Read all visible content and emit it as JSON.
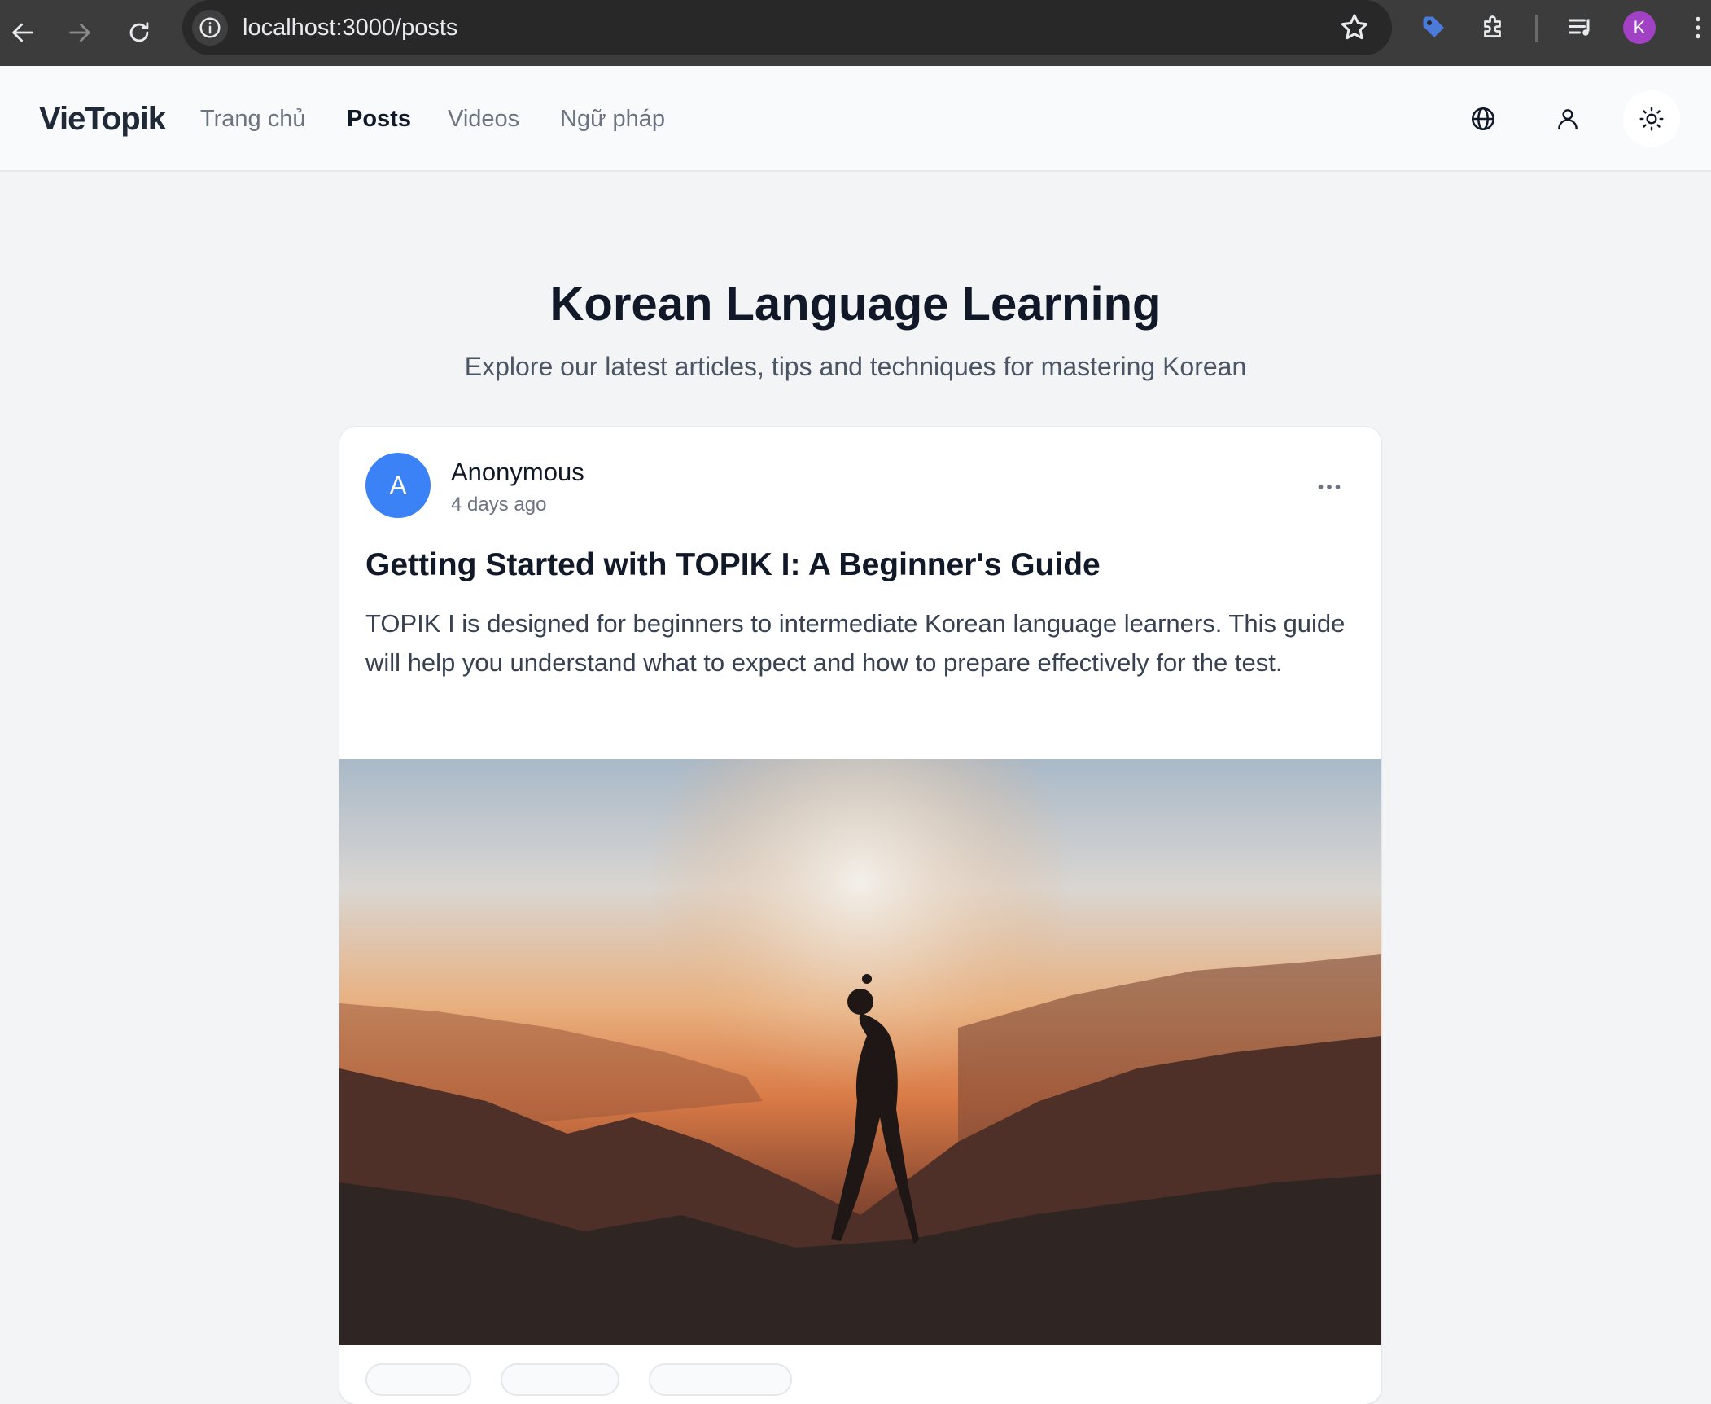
{
  "browser": {
    "url": "localhost:3000/posts",
    "profile_initial": "K"
  },
  "site": {
    "logo": "VieTopik",
    "nav": [
      {
        "label": "Trang chủ",
        "active": false
      },
      {
        "label": "Posts",
        "active": true
      },
      {
        "label": "Videos",
        "active": false
      },
      {
        "label": "Ngữ pháp",
        "active": false
      }
    ],
    "icons": [
      "globe-icon",
      "user-icon",
      "sun-icon"
    ]
  },
  "main": {
    "title": "Korean Language Learning",
    "subtitle": "Explore our latest articles, tips and techniques for mastering Korean",
    "posts": [
      {
        "author_initial": "A",
        "author": "Anonymous",
        "time": "4 days ago",
        "title": "Getting Started with TOPIK I: A Beginner's Guide",
        "excerpt": "TOPIK I is designed for beginners to intermediate Korean language learners. This guide will help you understand what to expect and how to prepare effectively for the test."
      }
    ]
  },
  "colors": {
    "accent": "#3b82f6",
    "profile": "#a142c4",
    "chrome_bg": "#3c3c3c"
  }
}
